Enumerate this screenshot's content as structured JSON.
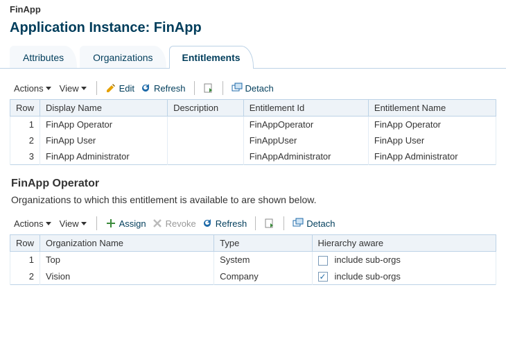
{
  "breadcrumb": "FinApp",
  "page_title": "Application Instance: FinApp",
  "tabs": {
    "attributes": "Attributes",
    "organizations": "Organizations",
    "entitlements": "Entitlements"
  },
  "entitlements_toolbar": {
    "actions": "Actions",
    "view": "View",
    "edit": "Edit",
    "refresh": "Refresh",
    "detach": "Detach"
  },
  "entitlements_table": {
    "headers": {
      "row": "Row",
      "display_name": "Display Name",
      "description": "Description",
      "entitlement_id": "Entitlement Id",
      "entitlement_name": "Entitlement Name"
    },
    "rows": [
      {
        "n": "1",
        "display_name": "FinApp Operator",
        "description": "",
        "entitlement_id": "FinAppOperator",
        "entitlement_name": "FinApp Operator"
      },
      {
        "n": "2",
        "display_name": "FinApp User",
        "description": "",
        "entitlement_id": "FinAppUser",
        "entitlement_name": "FinApp User"
      },
      {
        "n": "3",
        "display_name": "FinApp Administrator",
        "description": "",
        "entitlement_id": "FinAppAdministrator",
        "entitlement_name": "FinApp Administrator"
      }
    ]
  },
  "detail": {
    "heading": "FinApp Operator",
    "description": "Organizations to which this entitlement is available to are shown below."
  },
  "orgs_toolbar": {
    "actions": "Actions",
    "view": "View",
    "assign": "Assign",
    "revoke": "Revoke",
    "refresh": "Refresh",
    "detach": "Detach"
  },
  "orgs_table": {
    "headers": {
      "row": "Row",
      "org_name": "Organization Name",
      "type": "Type",
      "hierarchy": "Hierarchy aware"
    },
    "hierarchy_label": "include sub-orgs",
    "rows": [
      {
        "n": "1",
        "org_name": "Top",
        "type": "System",
        "checked": false
      },
      {
        "n": "2",
        "org_name": "Vision",
        "type": "Company",
        "checked": true
      }
    ]
  }
}
